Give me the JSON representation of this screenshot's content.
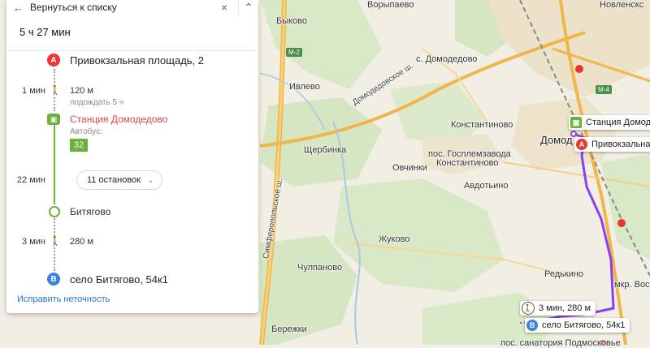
{
  "panel": {
    "back_label": "Вернуться к списку",
    "close_icon": "×",
    "collapse_icon": "⌃",
    "duration": "5 ч 27 мин",
    "start_badge": "A",
    "start_address": "Привокзальная площадь, 2",
    "walk1": {
      "time": "1 мин",
      "distance": "120 м",
      "wait": "подождать 5 ч"
    },
    "station": {
      "name": "Станция Домодедово",
      "transport_type": "Автобус:",
      "route": "32"
    },
    "ride": {
      "time": "22 мин",
      "stops_label": "11 остановок"
    },
    "transfer_stop": "Битягово",
    "walk2": {
      "time": "3 мин",
      "distance": "280 м"
    },
    "end_badge": "B",
    "end_address": "село Битягово, 54к1",
    "fix_link": "Исправить неточность"
  },
  "map": {
    "labels": {
      "vorypaevo": "Ворыпаево",
      "novleksk": "Новленскс",
      "bykovo": "Быково",
      "s_domodedovo": "с. Домодедово",
      "ivlevo": "Ивлево",
      "domodedovskoe": "Домодедовское ш.",
      "shcherbinka": "Щербинка",
      "konstantinovo": "Константиново",
      "domodedovo_city": "Домод",
      "gosplem": "пос. Госплемзавода",
      "konstantinovo2": "Константиново",
      "ovchinki": "Овчинки",
      "avdotino": "Авдотьино",
      "simferopol": "Симферопольское ш.",
      "zhukovo": "Жуково",
      "chulpanovo": "Чулпаново",
      "redkino": "Редькино",
      "mkr_vos": "мкр. Вос",
      "berezhki": "Бережки",
      "sanatorium": "пос. санатория Подмосковье"
    },
    "highways": {
      "m2": "М-2",
      "m4": "М-4"
    },
    "chips": {
      "station": "Станция Домод",
      "a_label": "Привокзальна",
      "walk": "3 мин, 280 м",
      "b_label": "село Битягово, 54к1"
    },
    "colors": {
      "route": "#8a3ff0",
      "bus_green": "#6cb13a",
      "point_a": "#e33333",
      "point_b": "#3b82e0"
    }
  }
}
